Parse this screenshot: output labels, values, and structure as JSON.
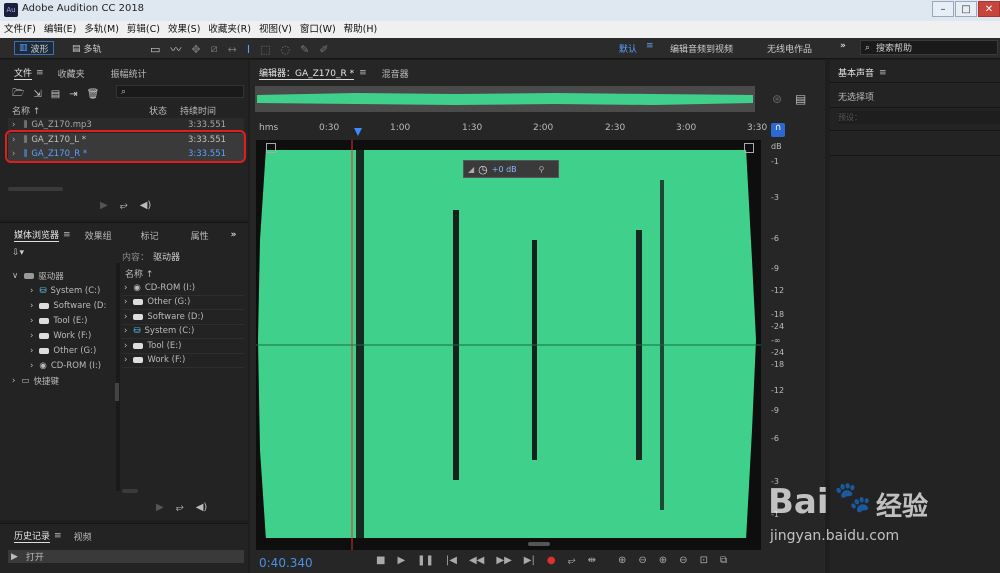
{
  "window": {
    "title": "Adobe Audition CC 2018",
    "app_icon": "Au"
  },
  "menu": [
    "文件(F)",
    "编辑(E)",
    "多轨(M)",
    "剪辑(C)",
    "效果(S)",
    "收藏夹(R)",
    "视图(V)",
    "窗口(W)",
    "帮助(H)"
  ],
  "toolbar": {
    "waveform": "波形",
    "multitrack": "多轨",
    "workspace_default": "默认",
    "workspace_edit_video": "编辑音频到视频",
    "workspace_radio": "无线电作品",
    "search_placeholder": "搜索帮助"
  },
  "files_panel": {
    "tabs": [
      "文件",
      "收藏夹",
      "振幅统计"
    ],
    "col_name": "名称",
    "col_status": "状态",
    "col_duration": "持续时间",
    "files": [
      {
        "name": "GA_Z170.mp3",
        "duration": "3:33.551",
        "selected": false
      },
      {
        "name": "GA_Z170_L *",
        "duration": "3:33.551",
        "selected": false
      },
      {
        "name": "GA_Z170_R *",
        "duration": "3:33.551",
        "selected": true
      }
    ]
  },
  "media_panel": {
    "tabs": [
      "媒体浏览器",
      "效果组",
      "标记",
      "属性"
    ],
    "content_label": "内容：",
    "content_value": "驱动器",
    "col_name": "名称",
    "root": "驱动器",
    "drives_left": [
      "System (C:)",
      "Software (D:",
      "Tool (E:)",
      "Work (F:)",
      "Other (G:)",
      "CD-ROM (I:)"
    ],
    "shortcuts": "快捷键",
    "drives_right": [
      "CD-ROM (I:)",
      "Other (G:)",
      "Software (D:)",
      "System (C:)",
      "Tool (E:)",
      "Work (F:)"
    ]
  },
  "history_panel": {
    "tabs": [
      "历史记录",
      "视频"
    ],
    "item": "打开"
  },
  "editor": {
    "tab": "编辑器：GA_Z170_R *",
    "tab2": "混音器",
    "ruler": [
      "hms",
      "0:30",
      "1:00",
      "1:30",
      "2:00",
      "2:30",
      "3:00",
      "3:30"
    ],
    "db_scale": [
      "dB",
      "-1",
      "-3",
      "-6",
      "-9",
      "-12",
      "-18",
      "-24",
      "-∞",
      "-24",
      "-18",
      "-12",
      "-9",
      "-6",
      "-3",
      "-1"
    ],
    "hud_gain": "+0 dB",
    "time": "0:40.340",
    "waveform_color": "#3fd18c"
  },
  "right_panel": {
    "title": "基本声音",
    "no_selection": "无选择项",
    "preset_label": "预设："
  },
  "watermark": {
    "brand": "Bai",
    "brand2": "经验",
    "url": "jingyan.baidu.com"
  }
}
